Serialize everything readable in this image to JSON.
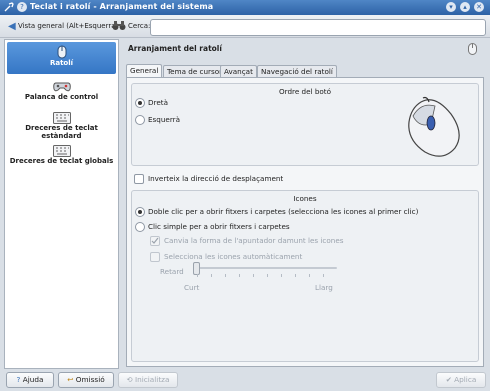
{
  "window": {
    "title": "Teclat i ratolí - Arranjament del sistema",
    "menu_icon": "tools-icon",
    "help_icon": "help-icon"
  },
  "toolbar": {
    "overview_label": "Vista general (Alt+Esquerra)",
    "search_label": "Cerca:",
    "search_value": "",
    "search_placeholder": ""
  },
  "sidebar": {
    "items": [
      {
        "label": "Ratolí",
        "icon": "mouse-icon",
        "active": true
      },
      {
        "label": "Palanca de control",
        "icon": "gamepad-icon",
        "active": false
      },
      {
        "label": "Dreceres de teclat estàndard",
        "icon": "keyboard-icon",
        "active": false
      },
      {
        "label": "Dreceres de teclat globals",
        "icon": "keyboard-icon",
        "active": false
      }
    ]
  },
  "main": {
    "title": "Arranjament del ratolí",
    "tabs": [
      {
        "label": "General",
        "active": true
      },
      {
        "label": "Tema de cursor",
        "active": false
      },
      {
        "label": "Avançat",
        "active": false
      },
      {
        "label": "Navegació del ratolí",
        "active": false
      }
    ],
    "button_order": {
      "title": "Ordre del botó",
      "options": [
        {
          "label": "Dretà",
          "checked": true
        },
        {
          "label": "Esquerrà",
          "checked": false
        }
      ]
    },
    "invert_scroll": {
      "label": "Inverteix la direcció de desplaçament",
      "checked": false
    },
    "icons": {
      "title": "Icones",
      "options": [
        {
          "label": "Doble clic per a obrir fitxers i carpetes (selecciona les icones al primer clic)",
          "checked": true
        },
        {
          "label": "Clic simple per a obrir fitxers i carpetes",
          "checked": false
        }
      ],
      "change_pointer": {
        "label": "Canvia la forma de l'apuntador damunt les icones",
        "checked": true
      },
      "auto_select": {
        "label": "Selecciona les icones automàticament",
        "checked": false
      },
      "delay": {
        "label": "Retard",
        "min_label": "Curt",
        "max_label": "Llarg",
        "value_fraction": 0.0
      }
    }
  },
  "buttons": {
    "help": "Ajuda",
    "default": "Omissió",
    "reset": "Inicialitza",
    "apply": "Aplica"
  }
}
